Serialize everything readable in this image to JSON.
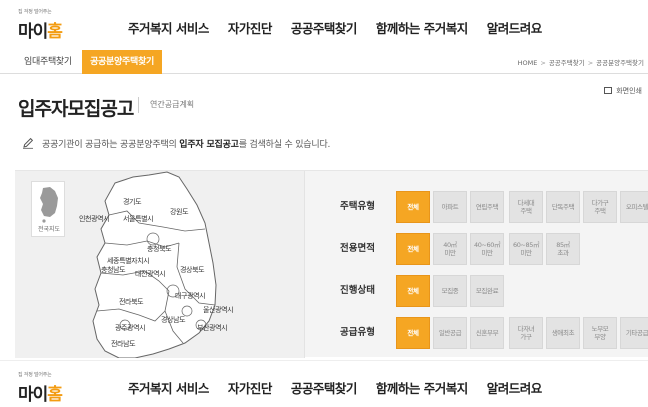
{
  "header": {
    "logo_tagline": "집 걱정 덜어주는",
    "logo_name_a": "마이",
    "logo_name_b": "홈",
    "menu": [
      "주거복지 서비스",
      "자가진단",
      "공공주택찾기",
      "함께하는 주거복지",
      "알려드려요"
    ]
  },
  "subnav": {
    "tabs": [
      "임대주택찾기",
      "공공분양주택찾기"
    ],
    "active_index": 1
  },
  "breadcrumb": [
    "HOME",
    "공공주택찾기",
    "공공분양주택찾기"
  ],
  "print_label": "화면인쇄",
  "title": "입주자모집공고",
  "title_sub": "연간공급계획",
  "description": {
    "pre": "공공기관이 공급하는 공공분양주택의 ",
    "bold": "입주자 모집공고",
    "post": "를 검색하실 수 있습니다."
  },
  "map": {
    "mini_label": "전국지도",
    "regions": [
      "경기도",
      "인천광역시",
      "서울특별시",
      "강원도",
      "충청북도",
      "세종특별자치시",
      "충청남도",
      "대전광역시",
      "경상북도",
      "전라북도",
      "대구광역시",
      "울산광역시",
      "경상남도",
      "광주광역시",
      "부산광역시",
      "전라남도"
    ]
  },
  "filters": [
    {
      "label": "주택유형",
      "options": [
        "전체",
        "아파트",
        "연립주택",
        "다세대\n주택",
        "단독주택",
        "다가구\n주택",
        "오피스텔"
      ]
    },
    {
      "label": "전용면적",
      "options": [
        "전체",
        "40㎡\n미만",
        "40~60㎡\n미만",
        "60~85㎡\n미만",
        "85㎡\n초과"
      ]
    },
    {
      "label": "진행상태",
      "options": [
        "전체",
        "모집중",
        "모집완료"
      ]
    },
    {
      "label": "공급유형",
      "options": [
        "전체",
        "일반공급",
        "신혼부부",
        "다자녀\n가구",
        "생애최초",
        "노부모\n부양",
        "기타공급"
      ]
    }
  ],
  "colors": {
    "accent": "#f5a623",
    "chip": "#e3e3e3"
  }
}
